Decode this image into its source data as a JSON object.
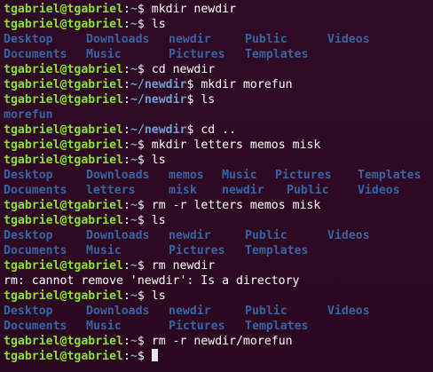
{
  "prompt_user": "tgabriel@tgabriel",
  "prompt_sep": ":",
  "home": "~",
  "home_newdir": "~/newdir",
  "dollar": "$ ",
  "cmds": {
    "c1": "mkdir newdir",
    "c2": "ls",
    "c3": "cd newdir",
    "c4": "mkdir morefun",
    "c5": "ls",
    "c6": "cd ..",
    "c7": "mkdir letters memos misk",
    "c8": "ls",
    "c9": "rm -r letters memos misk",
    "c10": "ls",
    "c11": "rm newdir",
    "c12": "ls",
    "c13": "rm -r newdir/morefun",
    "c14": ""
  },
  "ls1": {
    "row1": [
      "Desktop",
      "Downloads",
      "newdir",
      "Public",
      "Videos"
    ],
    "row2": [
      "Documents",
      "Music",
      "Pictures",
      "Templates"
    ]
  },
  "ls2": {
    "row1": [
      "morefun"
    ]
  },
  "ls3": {
    "row1": [
      "Desktop",
      "Downloads",
      "memos",
      "Music",
      "Pictures",
      "Templates"
    ],
    "row2": [
      "Documents",
      "letters",
      "misk",
      "newdir",
      "Public",
      "Videos"
    ]
  },
  "ls4": {
    "row1": [
      "Desktop",
      "Downloads",
      "newdir",
      "Public",
      "Videos"
    ],
    "row2": [
      "Documents",
      "Music",
      "Pictures",
      "Templates"
    ]
  },
  "error_msg": "rm: cannot remove 'newdir': Is a directory",
  "ls5": {
    "row1": [
      "Desktop",
      "Downloads",
      "newdir",
      "Public",
      "Videos"
    ],
    "row2": [
      "Documents",
      "Music",
      "Pictures",
      "Templates"
    ]
  },
  "colors": {
    "background": "#300a24",
    "user": "#8ae234",
    "path": "#729fcf",
    "directory": "#3465a4",
    "text": "#ffffff"
  }
}
